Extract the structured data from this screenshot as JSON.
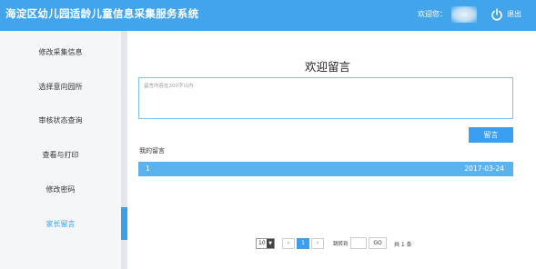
{
  "header": {
    "title": "海淀区幼儿园适龄儿童信息采集服务系统",
    "welcome": "欢迎您：",
    "logout": "退出",
    "accent": "#42a5ec"
  },
  "sidebar": {
    "items": [
      {
        "label": "修改采集信息"
      },
      {
        "label": "选择意向园所"
      },
      {
        "label": "审核状态查询"
      },
      {
        "label": "查看与打印"
      },
      {
        "label": "修改密码"
      },
      {
        "label": "家长留言"
      }
    ],
    "active_index": 5
  },
  "main": {
    "title": "欢迎留言",
    "textarea_placeholder": "留言内容在200字以内",
    "submit_label": "留言",
    "my_messages_label": "我的留言",
    "messages": [
      {
        "index": "1",
        "date": "2017-03-24"
      }
    ]
  },
  "pagination": {
    "page_size": "10",
    "prev": "‹",
    "current_page": "1",
    "next": "›",
    "jump_label": "跳转到",
    "go_label": "GO",
    "total": "共 1 条"
  }
}
